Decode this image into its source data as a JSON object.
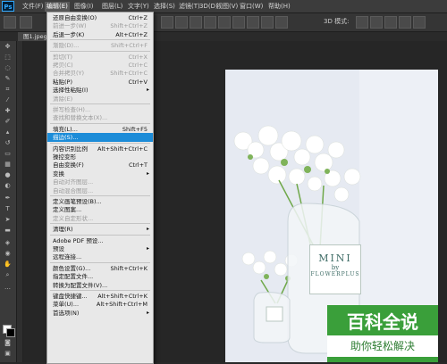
{
  "app": {
    "logo": "Ps"
  },
  "menubar": [
    "文件(F)",
    "编辑(E)",
    "图像(I)",
    "图层(L)",
    "文字(Y)",
    "选择(S)",
    "滤镜(T)",
    "3D(D)",
    "视图(V)",
    "窗口(W)",
    "帮助(H)"
  ],
  "options_bar": {
    "mode_label": "3D 模式:"
  },
  "document_tab": "图1.jpeg",
  "edit_menu": [
    {
      "label": "还原自由变换(O)",
      "shortcut": "Ctrl+Z",
      "state": "enabled"
    },
    {
      "label": "前进一步(W)",
      "shortcut": "Shift+Ctrl+Z",
      "state": "disabled"
    },
    {
      "label": "后退一步(K)",
      "shortcut": "Alt+Ctrl+Z",
      "state": "enabled"
    },
    {
      "sep": true
    },
    {
      "label": "渐隐(D)...",
      "shortcut": "Shift+Ctrl+F",
      "state": "disabled"
    },
    {
      "sep": true
    },
    {
      "label": "剪切(T)",
      "shortcut": "Ctrl+X",
      "state": "disabled"
    },
    {
      "label": "拷贝(C)",
      "shortcut": "Ctrl+C",
      "state": "disabled"
    },
    {
      "label": "合并拷贝(Y)",
      "shortcut": "Shift+Ctrl+C",
      "state": "disabled"
    },
    {
      "label": "粘贴(P)",
      "shortcut": "Ctrl+V",
      "state": "enabled"
    },
    {
      "label": "选择性粘贴(I)",
      "shortcut": "",
      "state": "enabled",
      "submenu": true
    },
    {
      "label": "清除(E)",
      "shortcut": "",
      "state": "disabled"
    },
    {
      "sep": true
    },
    {
      "label": "拼写检查(H)...",
      "shortcut": "",
      "state": "disabled"
    },
    {
      "label": "查找和替换文本(X)...",
      "shortcut": "",
      "state": "disabled"
    },
    {
      "sep": true
    },
    {
      "label": "填充(L)...",
      "shortcut": "Shift+F5",
      "state": "enabled"
    },
    {
      "label": "描边(S)...",
      "shortcut": "",
      "state": "highlight"
    },
    {
      "sep": true
    },
    {
      "label": "内容识别比例",
      "shortcut": "Alt+Shift+Ctrl+C",
      "state": "enabled"
    },
    {
      "label": "操控变形",
      "shortcut": "",
      "state": "enabled"
    },
    {
      "label": "自由变换(F)",
      "shortcut": "Ctrl+T",
      "state": "enabled"
    },
    {
      "label": "变换",
      "shortcut": "",
      "state": "enabled",
      "submenu": true
    },
    {
      "label": "自动对齐图层...",
      "shortcut": "",
      "state": "disabled"
    },
    {
      "label": "自动混合图层...",
      "shortcut": "",
      "state": "disabled"
    },
    {
      "sep": true
    },
    {
      "label": "定义画笔预设(B)...",
      "shortcut": "",
      "state": "enabled"
    },
    {
      "label": "定义图案...",
      "shortcut": "",
      "state": "enabled"
    },
    {
      "label": "定义自定形状...",
      "shortcut": "",
      "state": "disabled"
    },
    {
      "sep": true
    },
    {
      "label": "清理(R)",
      "shortcut": "",
      "state": "enabled",
      "submenu": true
    },
    {
      "sep": true
    },
    {
      "label": "Adobe PDF 预设...",
      "shortcut": "",
      "state": "enabled"
    },
    {
      "label": "预设",
      "shortcut": "",
      "state": "enabled",
      "submenu": true
    },
    {
      "label": "远程连接...",
      "shortcut": "",
      "state": "enabled"
    },
    {
      "sep": true
    },
    {
      "label": "颜色设置(G)...",
      "shortcut": "Shift+Ctrl+K",
      "state": "enabled"
    },
    {
      "label": "指定配置文件...",
      "shortcut": "",
      "state": "enabled"
    },
    {
      "label": "转换为配置文件(V)...",
      "shortcut": "",
      "state": "enabled"
    },
    {
      "sep": true
    },
    {
      "label": "键盘快捷键...",
      "shortcut": "Alt+Shift+Ctrl+K",
      "state": "enabled"
    },
    {
      "label": "菜单(U)...",
      "shortcut": "Alt+Shift+Ctrl+M",
      "state": "enabled"
    },
    {
      "label": "首选项(N)",
      "shortcut": "",
      "state": "enabled",
      "submenu": true
    }
  ],
  "photo": {
    "jar_big_line1": "MINI",
    "jar_big_line2": "by",
    "jar_big_line3": "FLOWERPLUS"
  },
  "watermark": {
    "title": "百科全说",
    "subtitle": "助你轻松解决"
  },
  "colors": {
    "highlight": "#1c8cd8",
    "menu_bg": "#e8e8e8",
    "app_bg": "#282828",
    "watermark": "#3a9f3a"
  }
}
